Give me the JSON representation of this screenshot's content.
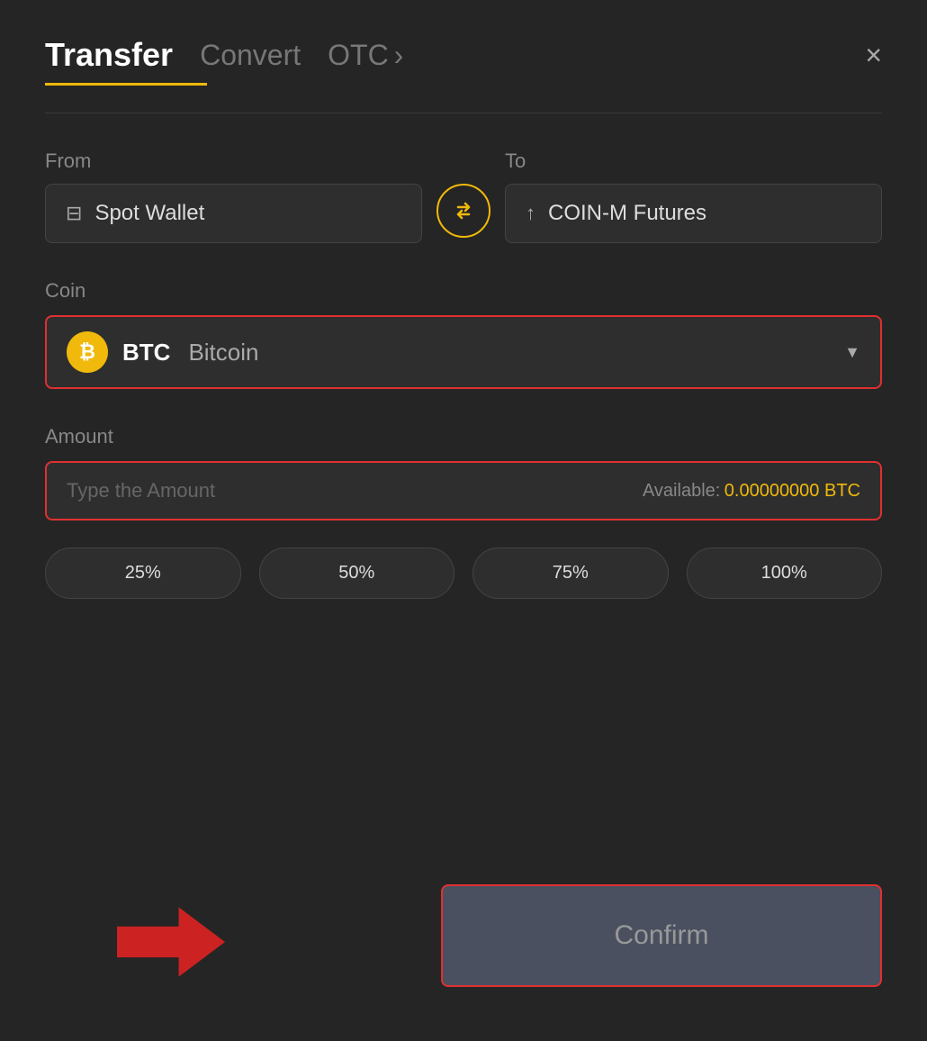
{
  "header": {
    "tab_transfer": "Transfer",
    "tab_convert": "Convert",
    "tab_otc": "OTC",
    "close_label": "×"
  },
  "from": {
    "label": "From",
    "wallet": "Spot Wallet"
  },
  "to": {
    "label": "To",
    "wallet": "COIN-M Futures"
  },
  "coin": {
    "label": "Coin",
    "symbol": "BTC",
    "name": "Bitcoin"
  },
  "amount": {
    "label": "Amount",
    "placeholder": "Type the Amount",
    "available_label": "Available:",
    "available_value": "0.00000000 BTC"
  },
  "percent_buttons": [
    {
      "label": "25%"
    },
    {
      "label": "50%"
    },
    {
      "label": "75%"
    },
    {
      "label": "100%"
    }
  ],
  "confirm_button": "Confirm"
}
